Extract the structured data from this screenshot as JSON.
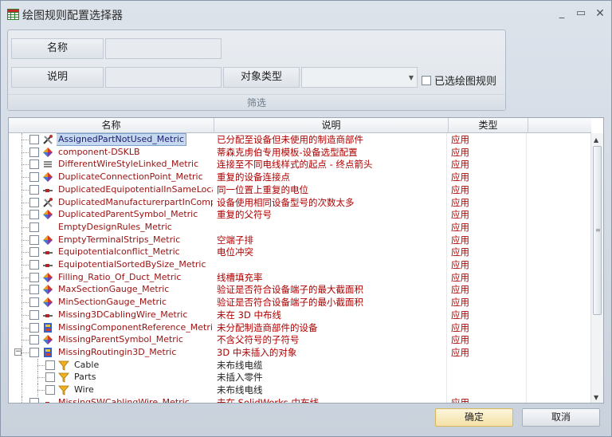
{
  "window": {
    "title": "绘图规则配置选择器",
    "min": "_",
    "max": "▭",
    "close": "✕"
  },
  "filter": {
    "name_label": "名称",
    "desc_label": "说明",
    "type_label": "对象类型",
    "type_value": "",
    "selected_only_label": "已选绘图规则",
    "selected_only_checked": false,
    "footer": "筛选"
  },
  "grid": {
    "columns": [
      "名称",
      "说明",
      "类型"
    ],
    "rows": [
      {
        "name": "AssignedPartNotUsed_Metric",
        "desc": "已分配至设备但未使用的制造商部件",
        "type": "应用",
        "icon": "tools-icon",
        "selected": true
      },
      {
        "name": "component-DSKLB",
        "desc": "蒂森克虏伯专用模板-设备选型配置",
        "type": "应用",
        "icon": "diamond-icon"
      },
      {
        "name": "DifferentWireStyleLinked_Metric",
        "desc": "连接至不同电线样式的起点 - 终点箭头",
        "type": "应用",
        "icon": "lines-icon"
      },
      {
        "name": "DuplicateConnectionPoint_Metric",
        "desc": "重复的设备连接点",
        "type": "应用",
        "icon": "diamond-icon"
      },
      {
        "name": "DuplicatedEquipotentialInSameLocatio...",
        "desc": "同一位置上重复的电位",
        "type": "应用",
        "icon": "wire-icon"
      },
      {
        "name": "DuplicatedManufacturerpartInCompon...",
        "desc": "设备使用相同设备型号的次数太多",
        "type": "应用",
        "icon": "tools-icon"
      },
      {
        "name": "DuplicatedParentSymbol_Metric",
        "desc": "重复的父符号",
        "type": "应用",
        "icon": "diamond-icon"
      },
      {
        "name": "EmptyDesignRules_Metric",
        "desc": "",
        "type": "应用",
        "icon": "blank-icon"
      },
      {
        "name": "EmptyTerminalStrips_Metric",
        "desc": "空端子排",
        "type": "应用",
        "icon": "diamond-icon"
      },
      {
        "name": "Equipotentialconflict_Metric",
        "desc": "电位冲突",
        "type": "应用",
        "icon": "wire-icon"
      },
      {
        "name": "EquipotentialSortedBySize_Metric",
        "desc": "",
        "type": "应用",
        "icon": "wire-icon"
      },
      {
        "name": "Filling_Ratio_Of_Duct_Metric",
        "desc": "线槽填充率",
        "type": "应用",
        "icon": "diamond-icon"
      },
      {
        "name": "MaxSectionGauge_Metric",
        "desc": "验证是否符合设备端子的最大截面积",
        "type": "应用",
        "icon": "diamond-icon"
      },
      {
        "name": "MinSectionGauge_Metric",
        "desc": "验证是否符合设备端子的最小截面积",
        "type": "应用",
        "icon": "diamond-icon"
      },
      {
        "name": "Missing3DCablingWire_Metric",
        "desc": "未在 3D 中布线",
        "type": "应用",
        "icon": "wire-icon"
      },
      {
        "name": "MissingComponentReference_Metric",
        "desc": "未分配制造商部件的设备",
        "type": "应用",
        "icon": "book-icon"
      },
      {
        "name": "MissingParentSymbol_Metric",
        "desc": "不含父符号的子符号",
        "type": "应用",
        "icon": "diamond-icon"
      },
      {
        "name": "MissingRoutingin3D_Metric",
        "desc": "3D 中未插入的对象",
        "type": "应用",
        "icon": "book-icon",
        "expander": "⊟"
      },
      {
        "name": "Cable",
        "desc": "未布线电缆",
        "type": "",
        "icon": "funnel-icon",
        "child": true
      },
      {
        "name": "Parts",
        "desc": "未插入零件",
        "type": "",
        "icon": "funnel-icon",
        "child": true
      },
      {
        "name": "Wire",
        "desc": "未布线电线",
        "type": "",
        "icon": "funnel-icon",
        "child": true
      },
      {
        "name": "MissingSWCablingWire_Metric",
        "desc": "未在 SolidWorks 中布线",
        "type": "应用",
        "icon": "wire-icon"
      }
    ]
  },
  "buttons": {
    "ok": "确定",
    "cancel": "取消"
  }
}
